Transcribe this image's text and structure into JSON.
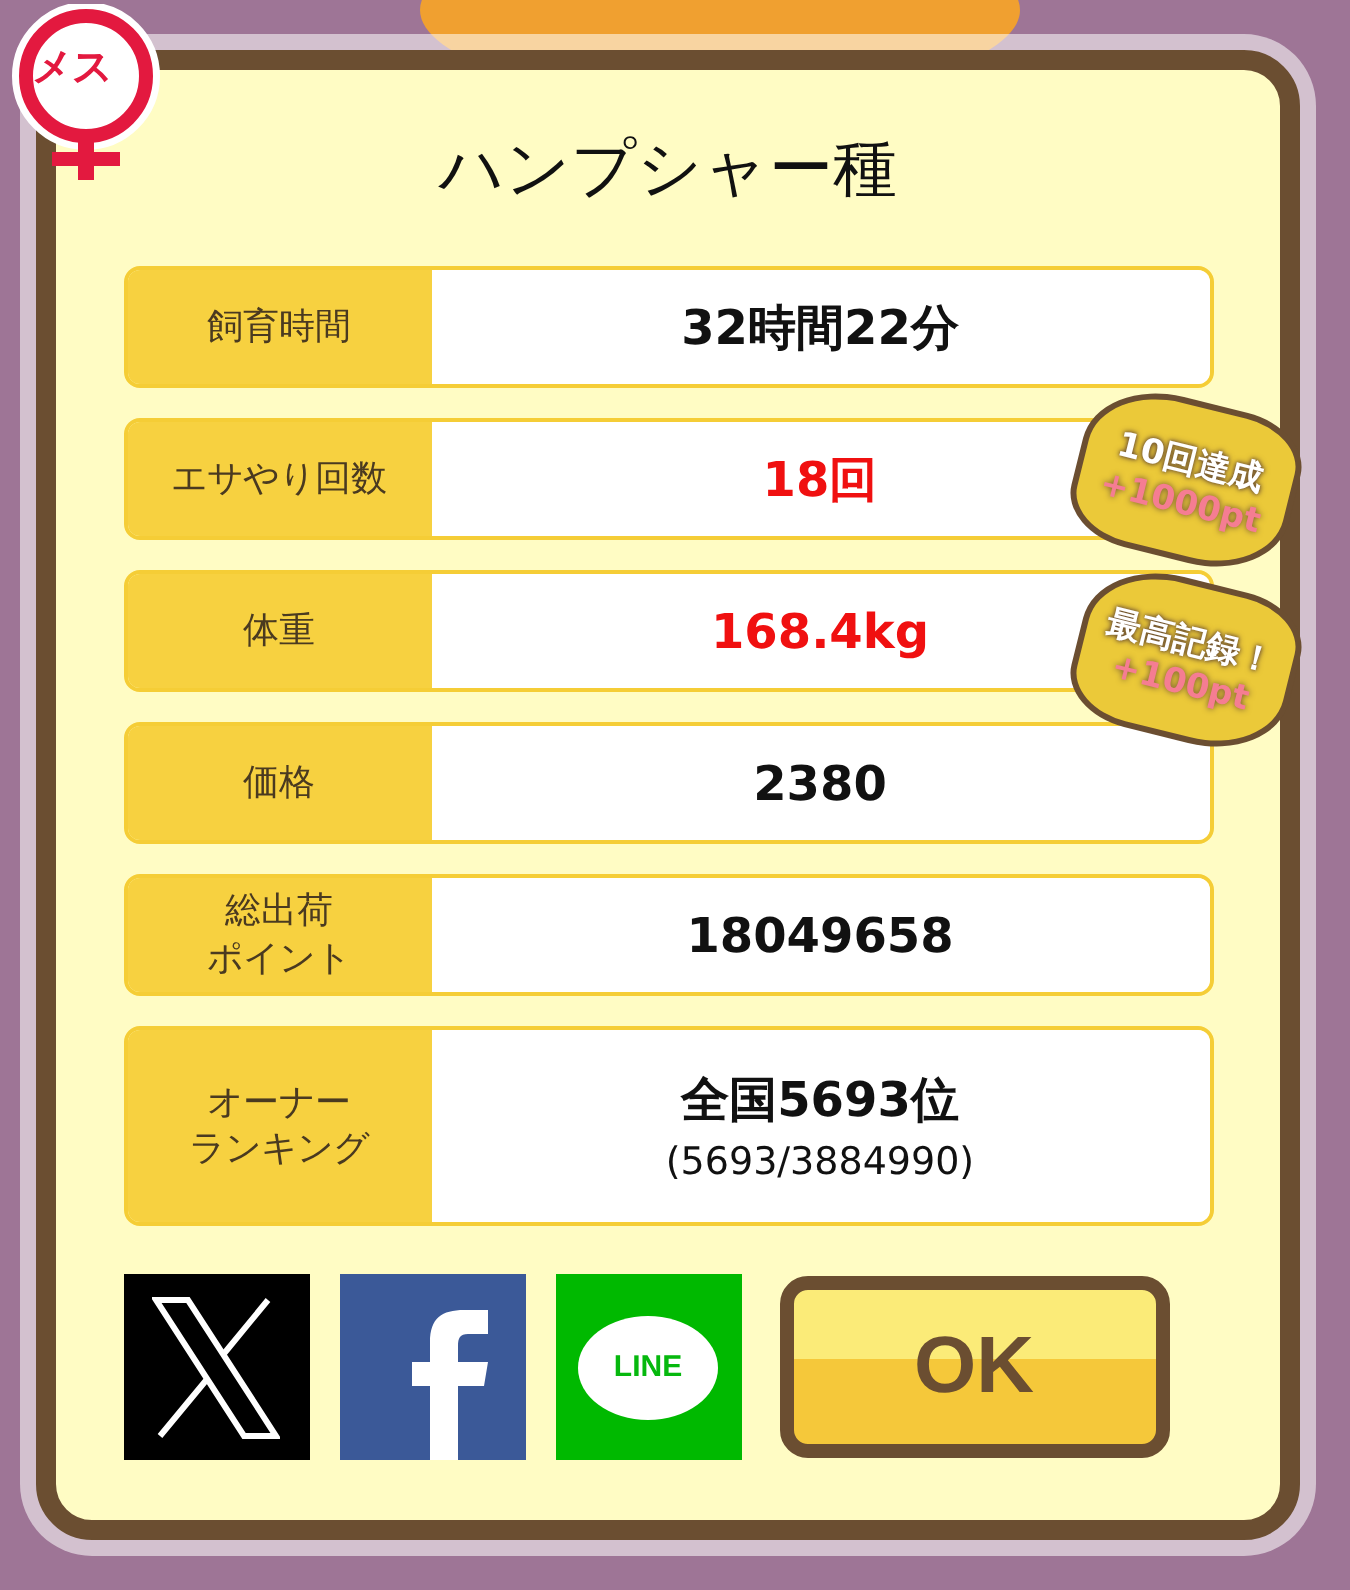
{
  "gender_badge": "メス",
  "title": "ハンプシャー種",
  "rows": [
    {
      "label": "飼育時間",
      "value": "32時間22分",
      "highlight": false
    },
    {
      "label": "エサやり回数",
      "value": "18回",
      "highlight": true
    },
    {
      "label": "体重",
      "value": "168.4kg",
      "highlight": true
    },
    {
      "label": "価格",
      "value": "2380",
      "highlight": false
    },
    {
      "label_lines": [
        "総出荷",
        "ポイント"
      ],
      "value": "18049658",
      "highlight": false
    },
    {
      "label_lines": [
        "オーナー",
        "ランキング"
      ],
      "value": "全国5693位",
      "sub": "(5693/3884990)",
      "highlight": false
    }
  ],
  "bonuses": [
    {
      "title": "10回達成",
      "points": "+1000pt"
    },
    {
      "title": "最高記録！",
      "points": "+100pt"
    }
  ],
  "share": [
    {
      "kind": "x"
    },
    {
      "kind": "facebook"
    },
    {
      "kind": "line",
      "label": "LINE"
    }
  ],
  "ok_button": "OK"
}
